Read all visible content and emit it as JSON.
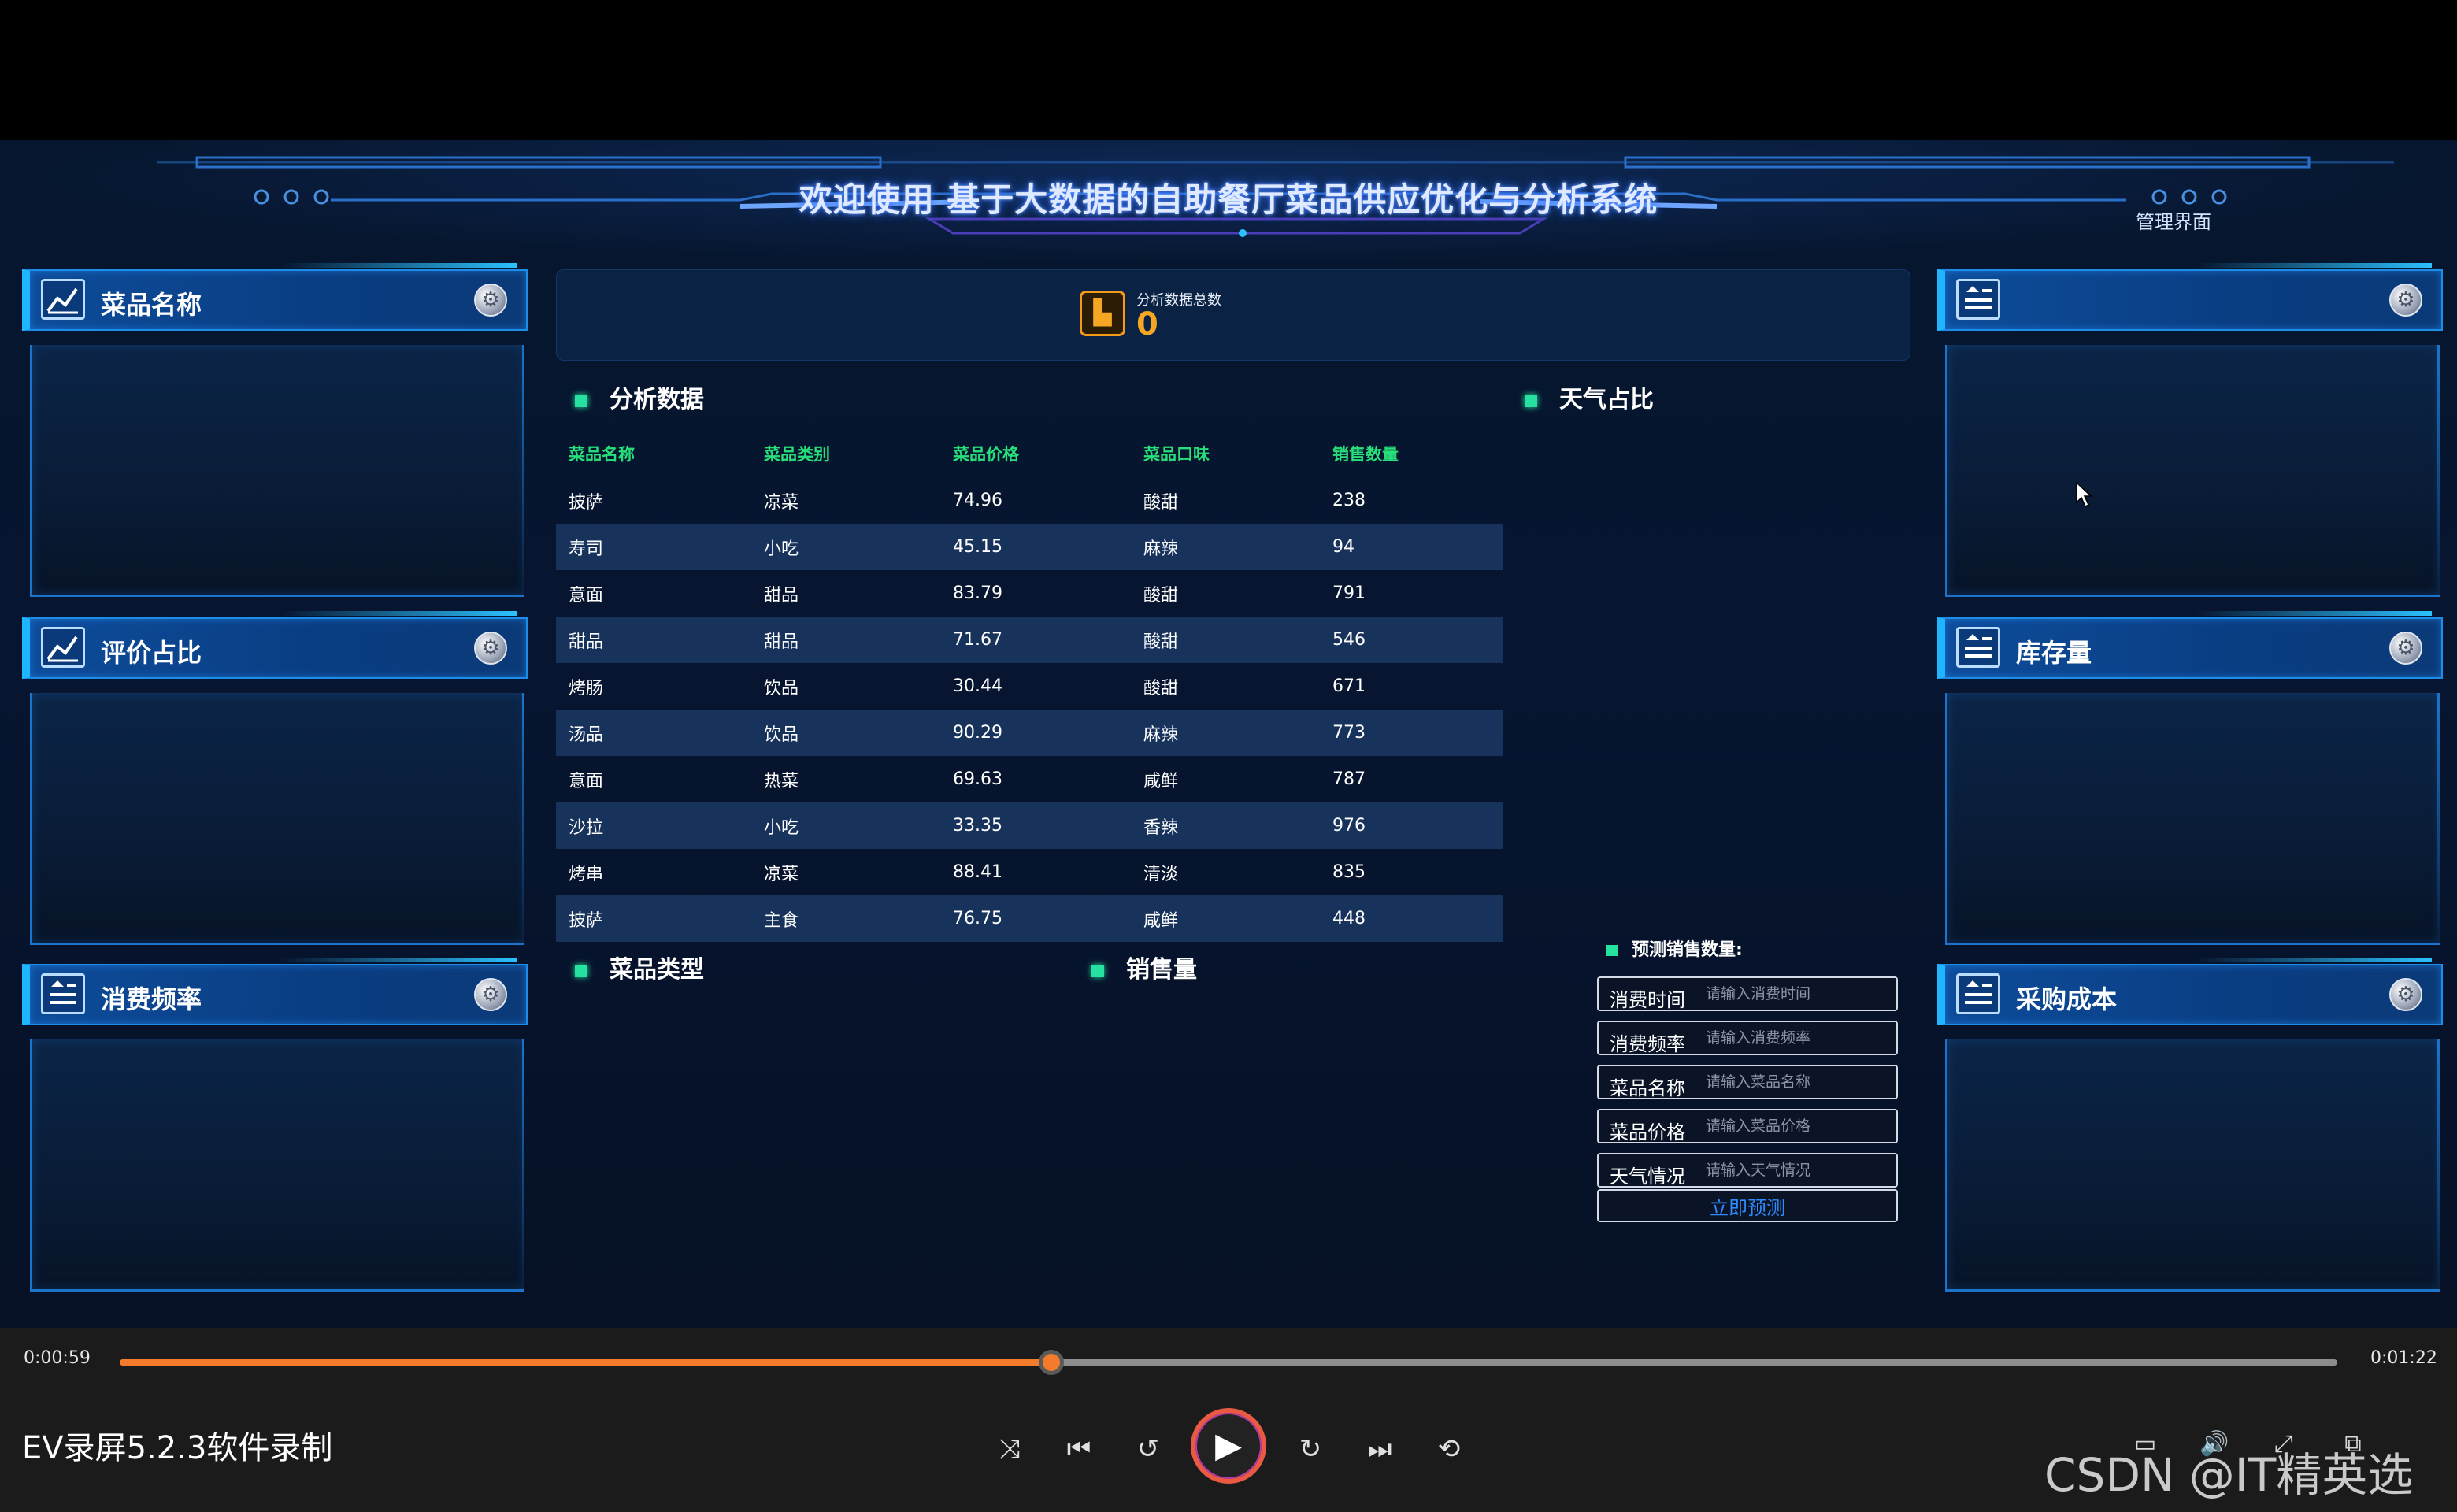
{
  "header": {
    "title": "欢迎使用 基于大数据的自助餐厅菜品供应优化与分析系统",
    "admin_link": "管理界面"
  },
  "left_panels": [
    {
      "title": "菜品名称",
      "icon": "chart-line-icon"
    },
    {
      "title": "评价占比",
      "icon": "chart-line-icon"
    },
    {
      "title": "消费频率",
      "icon": "list-icon"
    }
  ],
  "right_panels": [
    {
      "title": "",
      "icon": "list-icon"
    },
    {
      "title": "库存量",
      "icon": "list-icon"
    },
    {
      "title": "采购成本",
      "icon": "list-icon"
    }
  ],
  "stats": {
    "label": "分析数据总数",
    "value": "0"
  },
  "sections": {
    "analysis": "分析数据",
    "weather": "天气占比",
    "dish_type": "菜品类型",
    "sales": "销售量"
  },
  "table": {
    "headers": [
      "菜品名称",
      "菜品类别",
      "菜品价格",
      "菜品口味",
      "销售数量"
    ],
    "rows": [
      [
        "披萨",
        "凉菜",
        "74.96",
        "酸甜",
        "238"
      ],
      [
        "寿司",
        "小吃",
        "45.15",
        "麻辣",
        "94"
      ],
      [
        "意面",
        "甜品",
        "83.79",
        "酸甜",
        "791"
      ],
      [
        "甜品",
        "甜品",
        "71.67",
        "酸甜",
        "546"
      ],
      [
        "烤肠",
        "饮品",
        "30.44",
        "酸甜",
        "671"
      ],
      [
        "汤品",
        "饮品",
        "90.29",
        "麻辣",
        "773"
      ],
      [
        "意面",
        "热菜",
        "69.63",
        "咸鲜",
        "787"
      ],
      [
        "沙拉",
        "小吃",
        "33.35",
        "香辣",
        "976"
      ],
      [
        "烤串",
        "凉菜",
        "88.41",
        "清淡",
        "835"
      ],
      [
        "披萨",
        "主食",
        "76.75",
        "咸鲜",
        "448"
      ]
    ]
  },
  "predict": {
    "title": "预测销售数量:",
    "fields": [
      {
        "label": "消费时间",
        "placeholder": "请输入消费时间",
        "value": ""
      },
      {
        "label": "消费频率",
        "placeholder": "请输入消费频率",
        "value": ""
      },
      {
        "label": "菜品名称",
        "placeholder": "请输入菜品名称",
        "value": ""
      },
      {
        "label": "菜品价格",
        "placeholder": "请输入菜品价格",
        "value": ""
      },
      {
        "label": "天气情况",
        "placeholder": "请输入天气情况",
        "value": ""
      }
    ],
    "button": "立即预测"
  },
  "player": {
    "current_time": "0:00:59",
    "total_time": "0:01:22",
    "progress": 0.42,
    "title": "EV录屏5.2.3软件录制",
    "watermark": "CSDN @IT精英选手",
    "accent": "#f47a2c"
  }
}
